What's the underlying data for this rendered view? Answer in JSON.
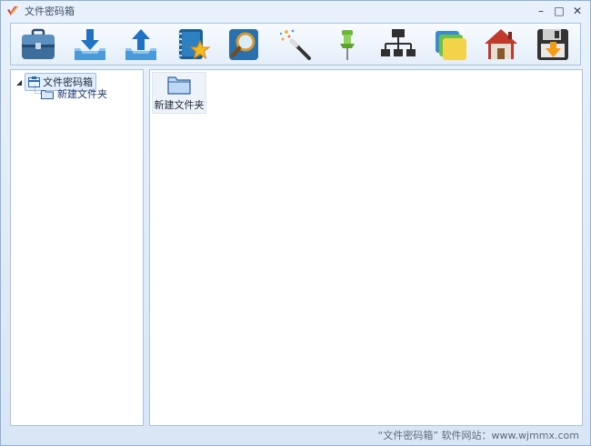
{
  "window": {
    "title": "文件密码箱",
    "controls": {
      "minimize": "–",
      "maximize": "□",
      "close": "✕"
    }
  },
  "toolbar": {
    "buttons": [
      {
        "name": "briefcase",
        "icon": "briefcase-icon"
      },
      {
        "name": "import",
        "icon": "download-tray-icon"
      },
      {
        "name": "export",
        "icon": "upload-tray-icon"
      },
      {
        "name": "favorites",
        "icon": "notebook-star-icon"
      },
      {
        "name": "search",
        "icon": "magnifier-icon"
      },
      {
        "name": "magic",
        "icon": "magic-wand-icon"
      },
      {
        "name": "pin",
        "icon": "pushpin-icon"
      },
      {
        "name": "network",
        "icon": "hierarchy-icon"
      },
      {
        "name": "folders",
        "icon": "folders-icon"
      },
      {
        "name": "home",
        "icon": "home-icon"
      },
      {
        "name": "save",
        "icon": "floppy-download-icon"
      }
    ]
  },
  "tree": {
    "root": {
      "label": "文件密码箱",
      "expander": "◢"
    },
    "children": [
      {
        "label": "新建文件夹"
      }
    ]
  },
  "content": {
    "items": [
      {
        "label": "新建文件夹"
      }
    ]
  },
  "status": {
    "text": "“文件密码箱” 软件网站：www.wjmmx.com"
  },
  "colors": {
    "accent": "#1e6fc6",
    "border": "#a9c3df",
    "background": "#dfeaf7",
    "folder": "#bcd8f4"
  }
}
